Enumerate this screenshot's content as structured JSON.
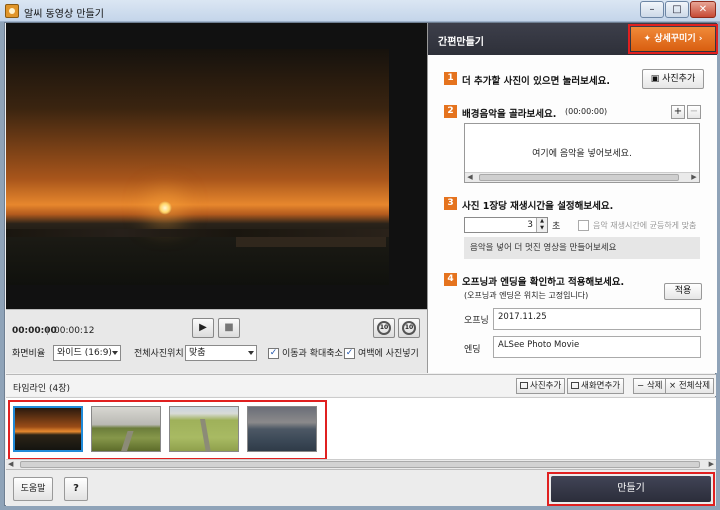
{
  "window": {
    "title": "알씨 동영상 만들기",
    "min": "–",
    "max": "□",
    "close": "✕"
  },
  "preview": {
    "time_current": "00:00:00",
    "time_separator": "|",
    "time_total": "00:00:12",
    "play": "▶",
    "stop": "■",
    "rewind_label": "10",
    "forward_label": "10"
  },
  "options": {
    "ratio_label": "화면비율",
    "ratio_value": "와이드 (16:9)",
    "position_label": "전체사진위치",
    "position_value": "맞춤",
    "move_zoom_label": "이동과 확대축소",
    "margin_label": "여백에 사진넣기",
    "move_zoom_checked": "✓",
    "margin_checked": "✓"
  },
  "panel": {
    "title": "간편만들기",
    "detail_button": "상세꾸미기",
    "step1": {
      "num": "1",
      "label": "더 추가할 사진이 있으면 눌러보세요.",
      "button": "사진추가"
    },
    "step2": {
      "num": "2",
      "label": "배경음악을 골라보세요.",
      "duration": "(00:00:00)",
      "placeholder": "여기에 음악을 넣어보세요.",
      "plus": "+",
      "minus": "−"
    },
    "step3": {
      "num": "3",
      "label": "사진 1장당 재생시간을 설정해보세요.",
      "seconds_value": "3",
      "seconds_unit": "초",
      "fit_music_label": "음악 재생시간에 균등하게 맞춤",
      "info": "음악을 넣어 더 멋진 영상을 만들어보세요"
    },
    "step4": {
      "num": "4",
      "label": "오프닝과 엔딩을 확인하고 적용해보세요.",
      "sublabel": "(오프닝과 엔딩은 위치는 고정입니다)",
      "apply_button": "적용",
      "opening_label": "오프닝",
      "opening_value": "2017.11.25",
      "ending_label": "엔딩",
      "ending_value": "ALSee Photo Movie"
    }
  },
  "timeline": {
    "title": "타임라인 (4장)",
    "add_photo": "사진추가",
    "new_screen": "새화면추가",
    "delete": "삭제",
    "delete_all": "전체삭제",
    "photo_count": 4
  },
  "footer": {
    "help": "도움말",
    "question": "?",
    "make": "만들기"
  },
  "colors": {
    "accent": "#e5731e",
    "highlight": "#e02020",
    "dark_header": "#2e3039",
    "selection": "#1f8ad8"
  }
}
